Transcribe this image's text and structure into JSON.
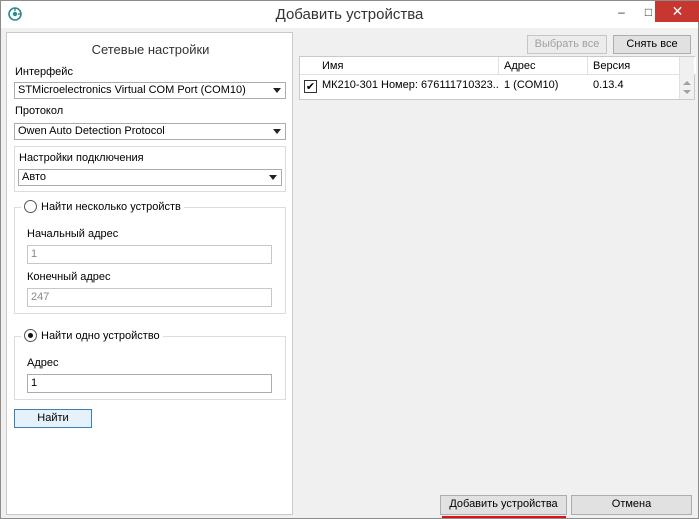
{
  "window": {
    "title": "Добавить устройства",
    "minimize": "–",
    "maximize": "□",
    "close": "✕"
  },
  "network": {
    "heading": "Сетевые настройки",
    "interface_label": "Интерфейс",
    "interface_value": "STMicroelectronics Virtual COM Port (COM10)",
    "protocol_label": "Протокол",
    "protocol_value": "Owen Auto Detection Protocol",
    "connection_label": "Настройки подключения",
    "connection_value": "Авто",
    "multi": {
      "title": "Найти несколько устройств",
      "start_label": "Начальный адрес",
      "start_value": "1",
      "end_label": "Конечный адрес",
      "end_value": "247",
      "selected": false
    },
    "single": {
      "title": "Найти одно устройство",
      "addr_label": "Адрес",
      "addr_value": "1",
      "selected": true
    },
    "find_button": "Найти"
  },
  "toolbar": {
    "select_all": "Выбрать все",
    "deselect_all": "Снять все"
  },
  "table": {
    "columns": [
      "Имя",
      "Адрес",
      "Версия"
    ],
    "rows": [
      {
        "checked": true,
        "name": "МК210-301 Номер: 676111710323...",
        "address": "1 (COM10)",
        "version": "0.13.4"
      }
    ]
  },
  "footer": {
    "add_button": "Добавить устройства",
    "cancel_button": "Отмена"
  },
  "colors": {
    "highlight_underline": "#e0101a",
    "close_button": "#c7372f"
  }
}
